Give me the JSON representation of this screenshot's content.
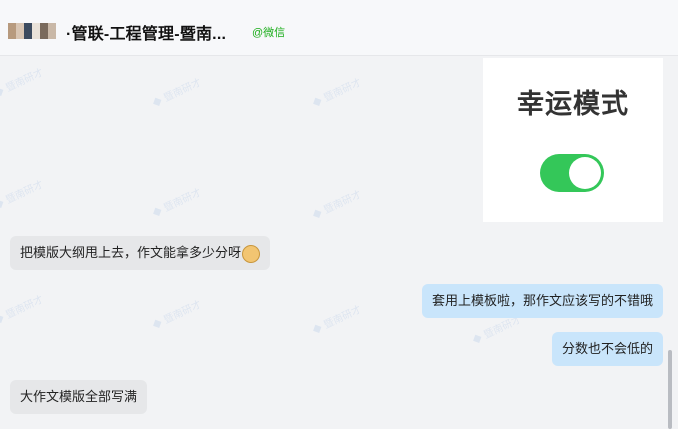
{
  "header": {
    "title": "·管联-工程管理-暨南...",
    "source": "@微信",
    "avatar_colors": [
      "#b79a7e",
      "#d8c5b3",
      "#3b4a5e",
      "#e9e2d9",
      "#7a6a5c",
      "#c9b8a7"
    ]
  },
  "card": {
    "title": "幸运模式",
    "toggle_on": true,
    "toggle_color": "#34c759"
  },
  "messages": [
    {
      "side": "left",
      "text": "把模版大纲甩上去，作文能拿多少分呀",
      "emoji": "cat-face-icon"
    },
    {
      "side": "right",
      "text": "套用上模板啦，那作文应该写的不错哦"
    },
    {
      "side": "right",
      "text": "分数也不会低的"
    },
    {
      "side": "left",
      "text": "大作文模版全部写满"
    }
  ],
  "watermark": "暨南研才"
}
